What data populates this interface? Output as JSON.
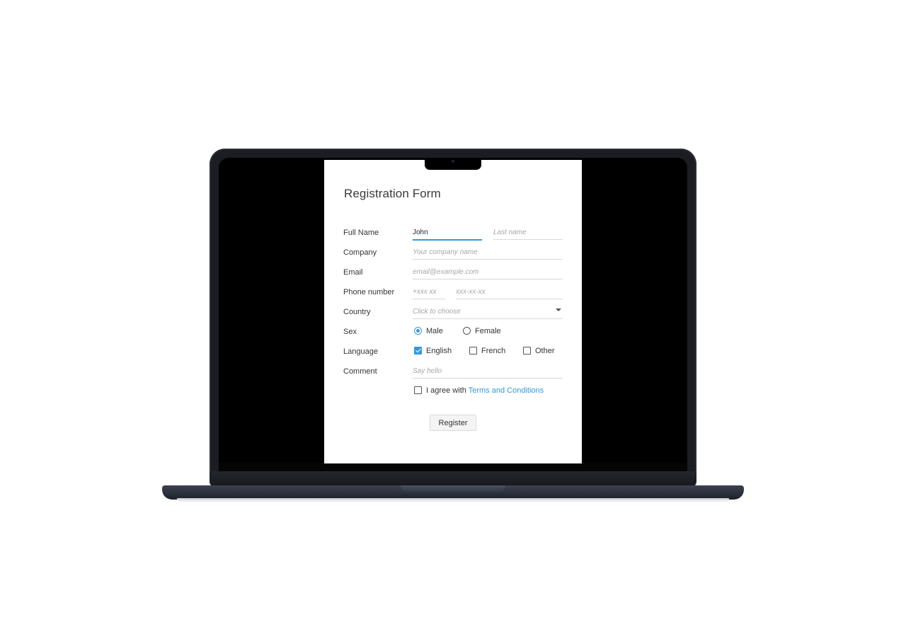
{
  "form": {
    "title": "Registration Form",
    "labels": {
      "full_name": "Full Name",
      "company": "Company",
      "email": "Email",
      "phone": "Phone number",
      "country": "Country",
      "sex": "Sex",
      "language": "Language",
      "comment": "Comment"
    },
    "fields": {
      "first_name_value": "John",
      "last_name_placeholder": "Last name",
      "company_placeholder": "Your company name",
      "email_placeholder": "email@example.com",
      "phone_code_placeholder": "+xxx xx",
      "phone_number_placeholder": "xxx-xx-xx",
      "country_placeholder": "Click to choose",
      "comment_placeholder": "Say hello"
    },
    "sex_options": [
      {
        "label": "Male",
        "selected": true
      },
      {
        "label": "Female",
        "selected": false
      }
    ],
    "language_options": [
      {
        "label": "English",
        "checked": true
      },
      {
        "label": "French",
        "checked": false
      },
      {
        "label": "Other",
        "checked": false
      }
    ],
    "agree": {
      "text": "I agree with",
      "link": "Terms and Conditions",
      "checked": false
    },
    "submit_label": "Register"
  },
  "colors": {
    "accent": "#3498db",
    "device_base": "#2a2f3a"
  }
}
